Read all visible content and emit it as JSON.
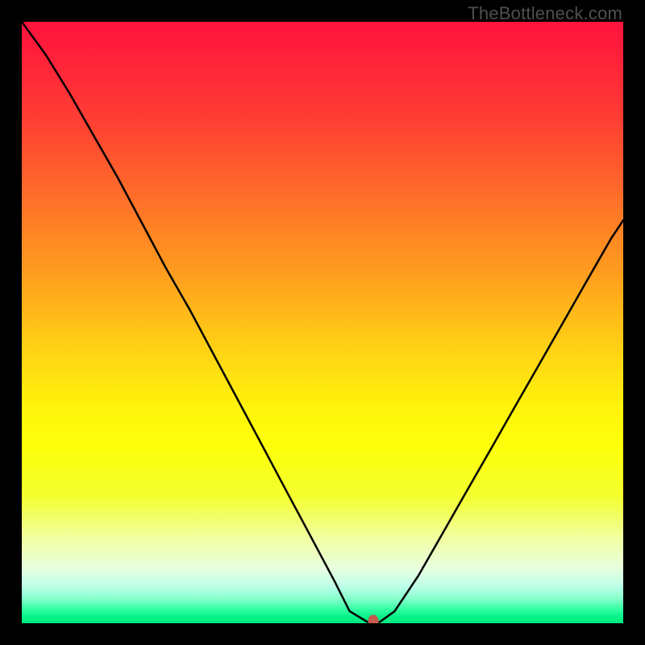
{
  "watermark": {
    "text": "TheBottleneck.com"
  },
  "colors": {
    "frame": "#000000",
    "curve": "#000000",
    "marker": "#c65a4c"
  },
  "chart_data": {
    "type": "line",
    "title": "",
    "xlabel": "",
    "ylabel": "",
    "xlim": [
      0,
      100
    ],
    "ylim": [
      0,
      100
    ],
    "grid": false,
    "legend": false,
    "series": [
      {
        "name": "bottleneck-curve",
        "x": [
          0,
          4,
          8,
          12,
          16,
          20,
          24,
          28,
          32,
          36,
          40,
          44,
          48,
          52,
          54.5,
          57.5,
          59.5,
          62,
          66,
          70,
          74,
          78,
          82,
          86,
          90,
          94,
          98,
          100
        ],
        "values": [
          100,
          94.5,
          88,
          81,
          74,
          66.5,
          59,
          52,
          44.5,
          37,
          29.5,
          22,
          14.5,
          7,
          2,
          0.2,
          0.2,
          2,
          8,
          15,
          22,
          29,
          36,
          43,
          50,
          57,
          64,
          67
        ]
      }
    ],
    "marker": {
      "x": 58.5,
      "y": 0.3
    },
    "gradient_stops": [
      {
        "pos": 0,
        "color": "#ff133b"
      },
      {
        "pos": 0.16,
        "color": "#ff3d34"
      },
      {
        "pos": 0.41,
        "color": "#ff9a1f"
      },
      {
        "pos": 0.64,
        "color": "#fff30b"
      },
      {
        "pos": 0.86,
        "color": "#f2ffa4"
      },
      {
        "pos": 0.96,
        "color": "#83ffc9"
      },
      {
        "pos": 1.0,
        "color": "#00e880"
      }
    ]
  }
}
